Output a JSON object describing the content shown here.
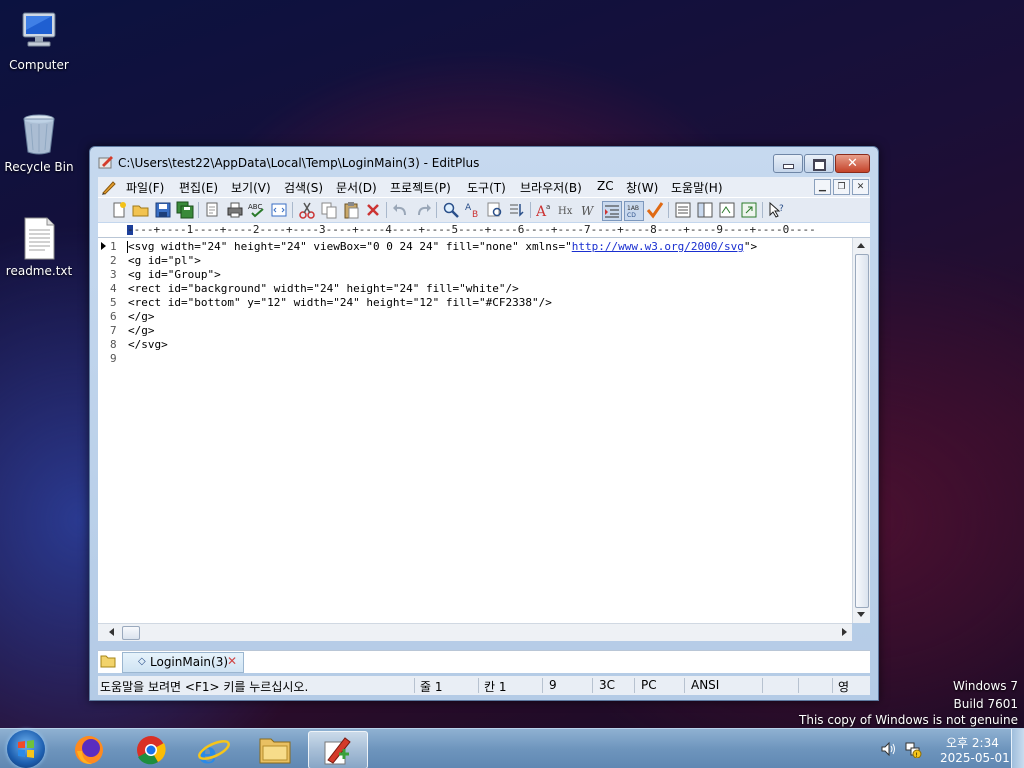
{
  "desktop": {
    "icons": [
      {
        "label": "Computer"
      },
      {
        "label": "Recycle Bin"
      },
      {
        "label": "readme.txt"
      }
    ],
    "watermark": {
      "line1": "Windows 7",
      "line2": "Build 7601",
      "line3": "This copy of Windows is not genuine"
    }
  },
  "window": {
    "title": "C:\\Users\\test22\\AppData\\Local\\Temp\\LoginMain(3) - EditPlus",
    "menu": [
      "파일(F)",
      "편집(E)",
      "보기(V)",
      "검색(S)",
      "문서(D)",
      "프로젝트(P)",
      "도구(T)",
      "브라우저(B)",
      "ZC",
      "창(W)",
      "도움말(H)"
    ],
    "ruler": "----+----1----+----2----+----3----+----4----+----5----+----6----+----7----+----8----+----9----+----0----",
    "lines": [
      {
        "num": "1",
        "pre": "<svg width=\"24\" height=\"24\" viewBox=\"0 0 24 24\" fill=\"none\" xmlns=\"",
        "link": "http://www.w3.org/2000/svg",
        "post": "\">"
      },
      {
        "num": "2",
        "text": "<g id=\"pl\">"
      },
      {
        "num": "3",
        "text": "<g id=\"Group\">"
      },
      {
        "num": "4",
        "text": "<rect id=\"background\" width=\"24\" height=\"24\" fill=\"white\"/>"
      },
      {
        "num": "5",
        "text": "<rect id=\"bottom\" y=\"12\" width=\"24\" height=\"12\" fill=\"#CF2338\"/>"
      },
      {
        "num": "6",
        "text": "</g>"
      },
      {
        "num": "7",
        "text": "</g>"
      },
      {
        "num": "8",
        "text": "</svg>"
      },
      {
        "num": "9",
        "text": ""
      }
    ],
    "tab": {
      "label": "LoginMain(3)"
    },
    "status": {
      "help": "도움말을 보려면 <F1> 키를 누르십시오.",
      "line": "줄 1",
      "col": "칸 1",
      "count": "9",
      "hex": "3C",
      "mode": "PC",
      "encoding": "ANSI",
      "ime": "영"
    }
  },
  "taskbar": {
    "clock": {
      "time": "오후 2:34",
      "date": "2025-05-01"
    }
  }
}
